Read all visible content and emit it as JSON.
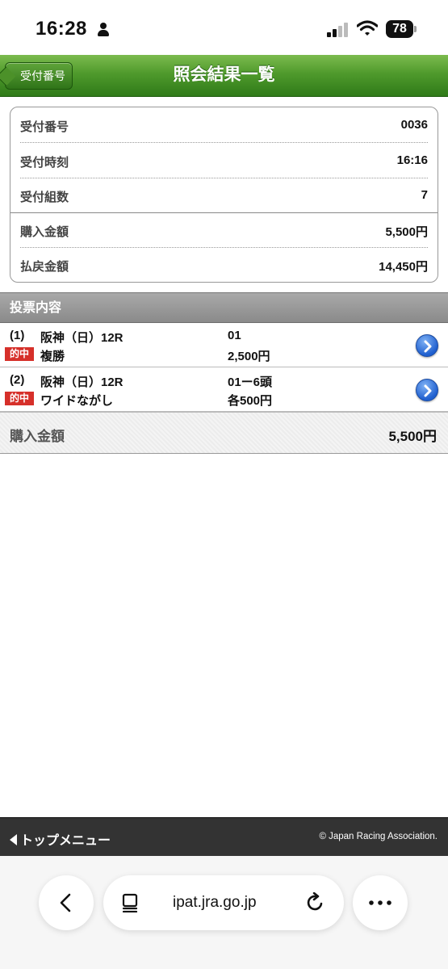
{
  "status_bar": {
    "time": "16:28",
    "battery": "78"
  },
  "header": {
    "back_label": "受付番号",
    "title": "照会結果一覧"
  },
  "summary": {
    "rows": [
      {
        "label": "受付番号",
        "value": "0036"
      },
      {
        "label": "受付時刻",
        "value": "16:16"
      },
      {
        "label": "受付組数",
        "value": "7"
      },
      {
        "label": "購入金額",
        "value": "5,500円"
      },
      {
        "label": "払戻金額",
        "value": "14,450円"
      }
    ]
  },
  "section": {
    "title": "投票内容"
  },
  "bets": [
    {
      "num": "(1)",
      "race": "阪神（日）12R",
      "badge": "的中",
      "type": "複勝",
      "horse": "01",
      "amount": "2,500円"
    },
    {
      "num": "(2)",
      "race": "阪神（日）12R",
      "badge": "的中",
      "type": "ワイドながし",
      "horse": "01ー6頭",
      "amount": "各500円"
    }
  ],
  "total": {
    "label": "購入金額",
    "value": "5,500円"
  },
  "footer": {
    "top_menu": "トップメニュー",
    "copyright": "© Japan Racing Association."
  },
  "browser": {
    "url": "ipat.jra.go.jp"
  },
  "colors": {
    "header_green": "#4f9a2c",
    "badge_red": "#d6302a",
    "section_gray": "#999999",
    "footer_dark": "#333333"
  },
  "icons": [
    "person-icon",
    "signal-icon",
    "wifi-icon",
    "chevron-right-icon",
    "back-arrow-icon",
    "tabs-icon",
    "reload-icon",
    "more-icon"
  ]
}
